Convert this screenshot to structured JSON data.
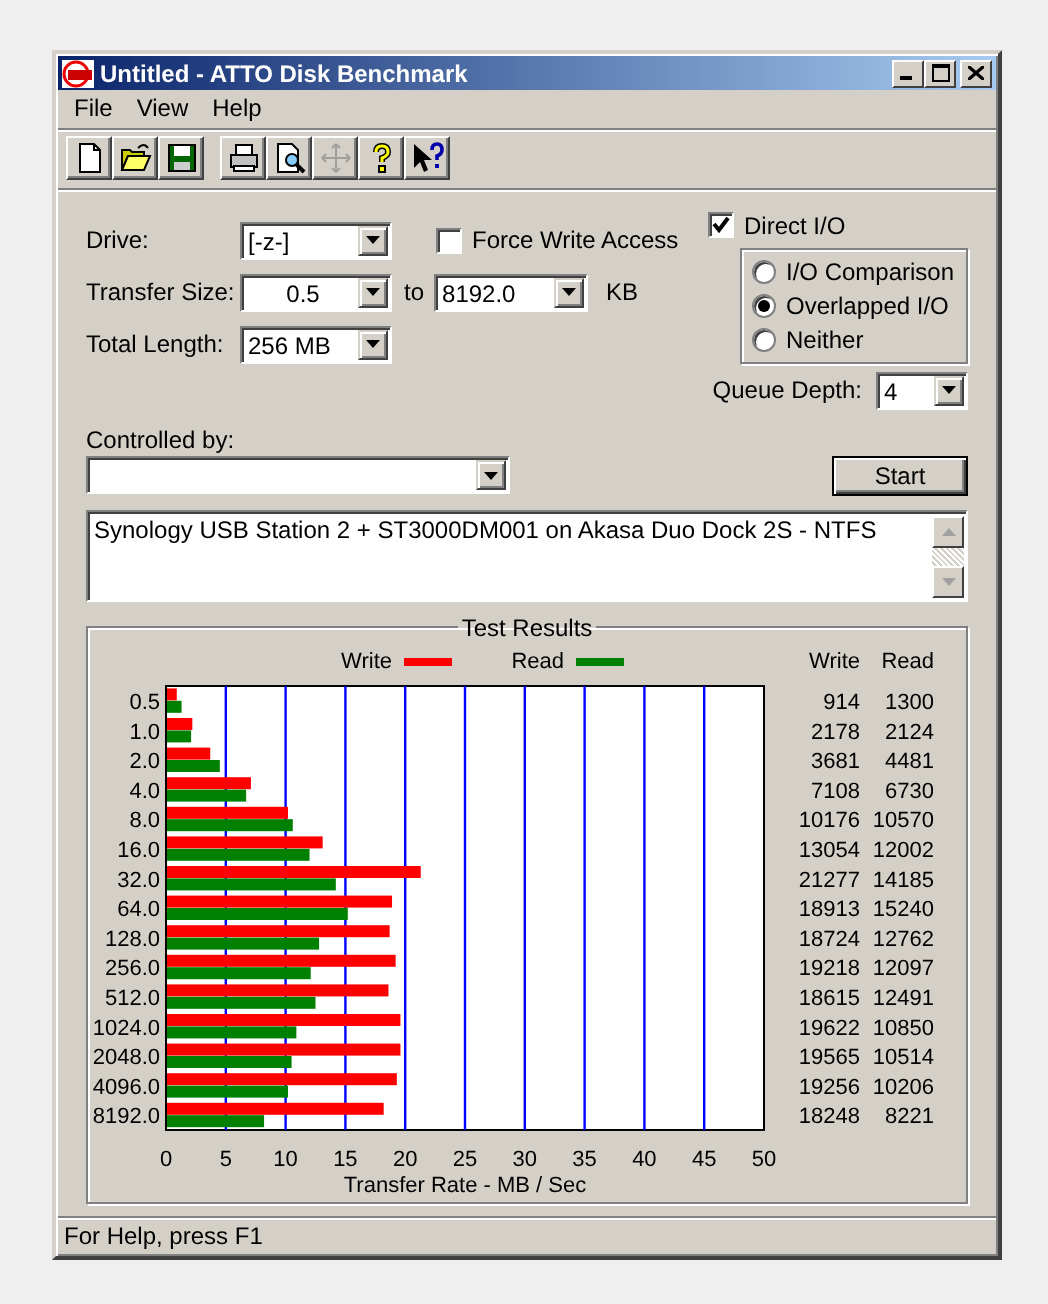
{
  "window": {
    "title": "Untitled - ATTO Disk Benchmark"
  },
  "menu": [
    {
      "label": "File"
    },
    {
      "label": "View"
    },
    {
      "label": "Help"
    }
  ],
  "toolbar": [
    {
      "kind": "new",
      "disabled": false
    },
    {
      "kind": "open",
      "disabled": false
    },
    {
      "kind": "save",
      "disabled": false
    },
    {
      "kind": "print",
      "disabled": false
    },
    {
      "kind": "preview",
      "disabled": false
    },
    {
      "kind": "move",
      "disabled": true
    },
    {
      "kind": "help",
      "disabled": false
    },
    {
      "kind": "context_help",
      "disabled": false
    }
  ],
  "drive": {
    "label": "Drive:",
    "value": "[-z-]"
  },
  "force_write_access": {
    "label": "Force Write Access",
    "checked": false
  },
  "transfer_size": {
    "label": "Transfer Size:",
    "from": "0.5",
    "to_label": "to",
    "to": "8192.0",
    "unit": "KB"
  },
  "total_length": {
    "label": "Total Length:",
    "value": "256 MB"
  },
  "direct_io": {
    "label": "Direct I/O",
    "checked": true
  },
  "io_mode": [
    {
      "label": "I/O Comparison",
      "selected": false
    },
    {
      "label": "Overlapped I/O",
      "selected": true
    },
    {
      "label": "Neither",
      "selected": false
    }
  ],
  "queue_depth": {
    "label": "Queue Depth:",
    "value": "4"
  },
  "controlled_by": {
    "label": "Controlled by:"
  },
  "start_button": {
    "label": "Start"
  },
  "description": "Synology USB Station 2 + ST3000DM001 on Akasa Duo Dock 2S - NTFS",
  "results": {
    "title": "Test Results",
    "chart_data": {
      "type": "bar",
      "orientation": "horizontal",
      "grid": true,
      "legend": "top",
      "xlabel": "Transfer Rate - MB / Sec",
      "xlim": [
        0,
        50
      ],
      "xticks": [
        0,
        5,
        10,
        15,
        20,
        25,
        30,
        35,
        40,
        45,
        50
      ],
      "categories": [
        "0.5",
        "1.0",
        "2.0",
        "4.0",
        "8.0",
        "16.0",
        "32.0",
        "64.0",
        "128.0",
        "256.0",
        "512.0",
        "1024.0",
        "2048.0",
        "4096.0",
        "8192.0"
      ],
      "series": [
        {
          "name": "Write",
          "color": "#ff0000",
          "values": [
            0.9,
            2.2,
            3.7,
            7.1,
            10.2,
            13.1,
            21.3,
            18.9,
            18.7,
            19.2,
            18.6,
            19.6,
            19.6,
            19.3,
            18.2
          ]
        },
        {
          "name": "Read",
          "color": "#008000",
          "values": [
            1.3,
            2.1,
            4.5,
            6.7,
            10.6,
            12.0,
            14.2,
            15.2,
            12.8,
            12.1,
            12.5,
            10.9,
            10.5,
            10.2,
            8.2
          ]
        }
      ]
    },
    "table": {
      "columns": [
        "Write",
        "Read"
      ],
      "rows": [
        [
          "914",
          "1300"
        ],
        [
          "2178",
          "2124"
        ],
        [
          "3681",
          "4481"
        ],
        [
          "7108",
          "6730"
        ],
        [
          "10176",
          "10570"
        ],
        [
          "13054",
          "12002"
        ],
        [
          "21277",
          "14185"
        ],
        [
          "18913",
          "15240"
        ],
        [
          "18724",
          "12762"
        ],
        [
          "19218",
          "12097"
        ],
        [
          "18615",
          "12491"
        ],
        [
          "19622",
          "10850"
        ],
        [
          "19565",
          "10514"
        ],
        [
          "19256",
          "10206"
        ],
        [
          "18248",
          "8221"
        ]
      ]
    }
  },
  "status_bar": "For Help, press F1"
}
